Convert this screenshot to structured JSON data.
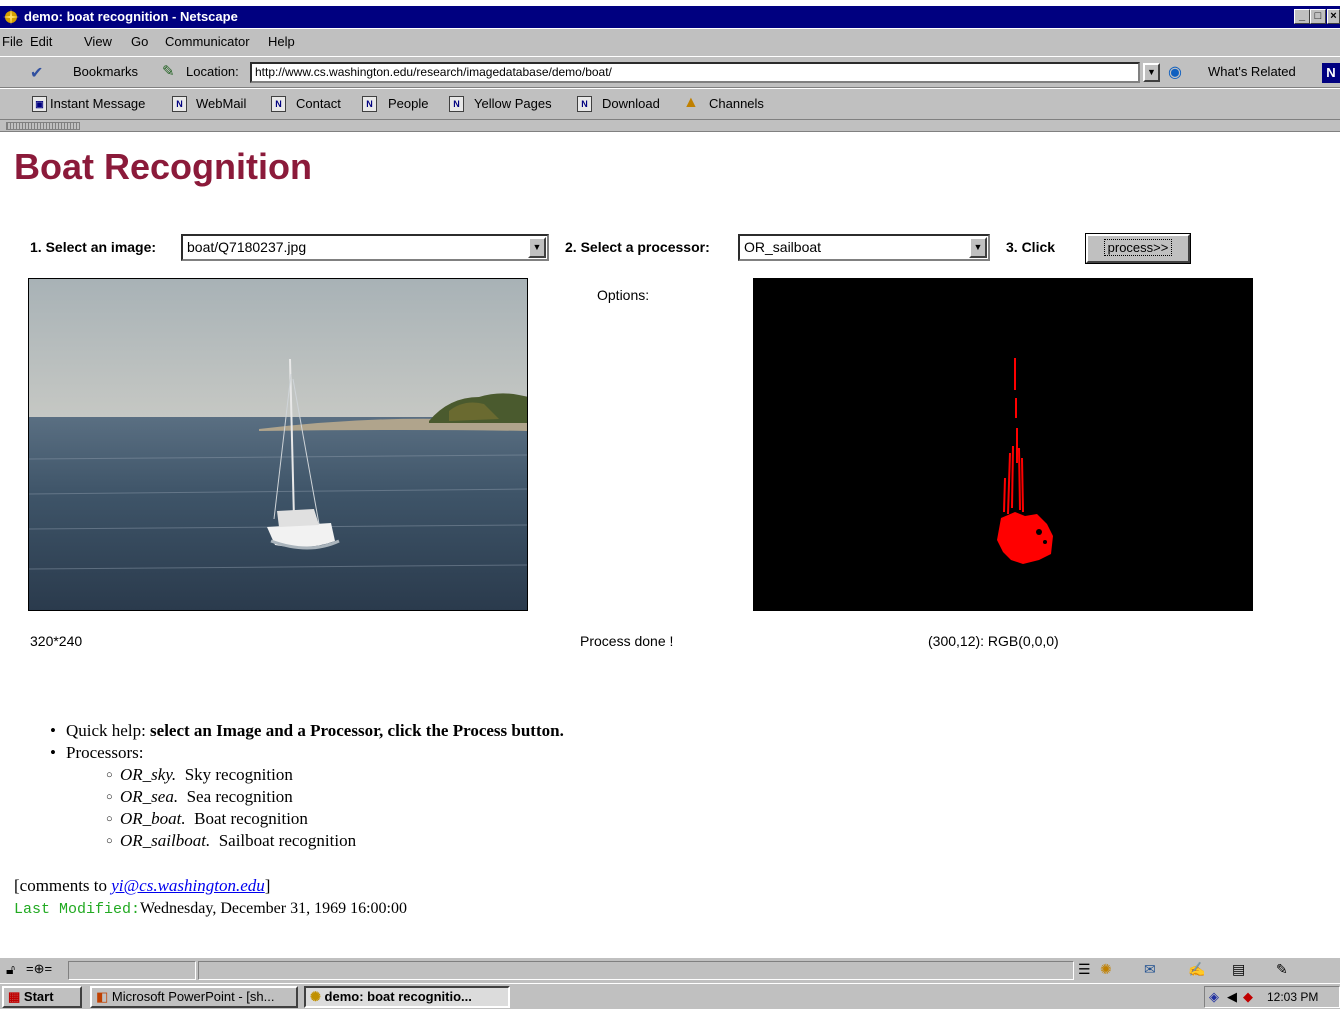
{
  "window": {
    "title": "demo: boat recognition - Netscape",
    "controls": [
      "_",
      "□",
      "×"
    ]
  },
  "menu": [
    "File",
    "Edit",
    "View",
    "Go",
    "Communicator",
    "Help"
  ],
  "location_toolbar": {
    "bookmarks_label": "Bookmarks",
    "location_label": "Location:",
    "url": "http://www.cs.washington.edu/research/imagedatabase/demo/boat/",
    "whats_related_label": "What's Related"
  },
  "personal_toolbar": [
    "Instant Message",
    "WebMail",
    "Contact",
    "People",
    "Yellow Pages",
    "Download",
    "Channels"
  ],
  "page": {
    "title": "Boat Recognition",
    "step1_label": "1. Select an image:",
    "image_select_value": "boat/Q7180237.jpg",
    "step2_label": "2. Select a processor:",
    "processor_select_value": "OR_sailboat",
    "step3_label": "3. Click",
    "process_button_label": "process>>",
    "options_label": "Options:",
    "image_size": "320*240",
    "process_status": "Process done !",
    "pixel_info": "(300,12): RGB(0,0,0)"
  },
  "help": {
    "quick_help_prefix": "Quick help: ",
    "quick_help_bold": "select an Image and a Processor, click the Process button.",
    "processors_label": "Processors:",
    "processors": [
      {
        "name": "OR_sky.",
        "desc": "Sky recognition"
      },
      {
        "name": "OR_sea.",
        "desc": "Sea recognition"
      },
      {
        "name": "OR_boat.",
        "desc": "Boat recognition"
      },
      {
        "name": "OR_sailboat.",
        "desc": "Sailboat recognition"
      }
    ]
  },
  "footer": {
    "comments_prefix": "[comments to ",
    "email": "yi@cs.washington.edu",
    "comments_suffix": "]",
    "last_modified_label": "Last Modified:",
    "last_modified_value": "Wednesday, December 31, 1969 16:00:00"
  },
  "taskbar": {
    "start_label": "Start",
    "tasks": [
      "Microsoft PowerPoint - [sh...",
      "demo: boat recognitio..."
    ],
    "clock": "12:03 PM"
  },
  "colors": {
    "title_accent": "#8b1a3a",
    "detection": "#ff0000",
    "last_modified_label": "#22aa22",
    "titlebar": "#000080"
  }
}
